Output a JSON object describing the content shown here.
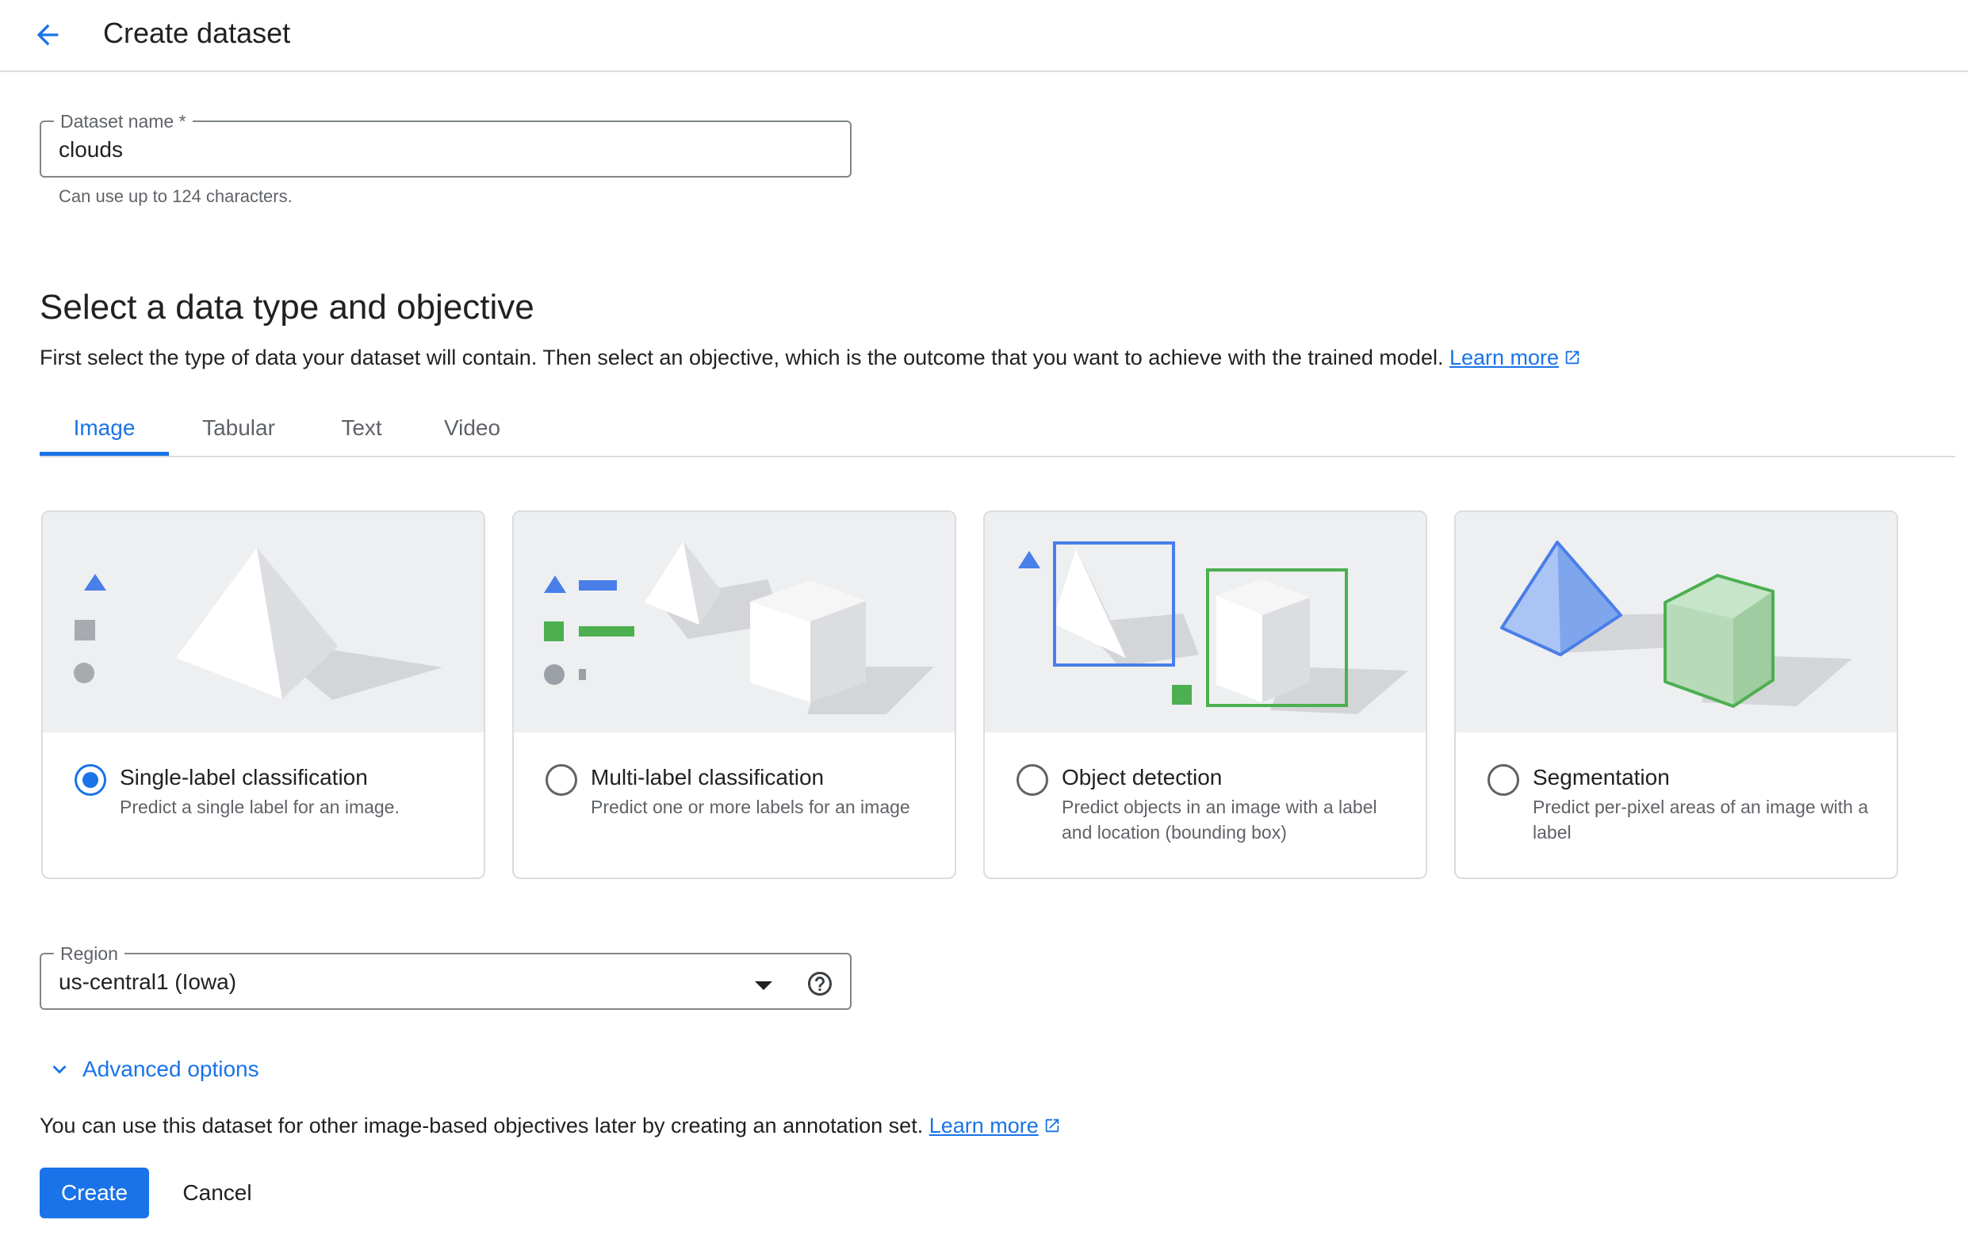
{
  "header": {
    "back_icon": "arrow-back-icon",
    "title": "Create dataset"
  },
  "dataset_name": {
    "label": "Dataset name *",
    "value": "clouds",
    "hint": "Can use up to 124 characters."
  },
  "section": {
    "title": "Select a data type and objective",
    "description": "First select the type of data your dataset will contain. Then select an objective, which is the outcome that you want to achieve with the trained model.",
    "learn_more": "Learn more"
  },
  "tabs": [
    {
      "label": "Image",
      "active": true
    },
    {
      "label": "Tabular",
      "active": false
    },
    {
      "label": "Text",
      "active": false
    },
    {
      "label": "Video",
      "active": false
    }
  ],
  "objectives": [
    {
      "title": "Single-label classification",
      "description": "Predict a single label for an image.",
      "selected": true
    },
    {
      "title": "Multi-label classification",
      "description": "Predict one or more labels for an image",
      "selected": false
    },
    {
      "title": "Object detection",
      "description": "Predict objects in an image with a label and location (bounding box)",
      "selected": false
    },
    {
      "title": "Segmentation",
      "description": "Predict per-pixel areas of an image with a label",
      "selected": false
    }
  ],
  "region": {
    "label": "Region",
    "value": "us-central1 (Iowa)",
    "help_icon": "help-circle-icon"
  },
  "advanced_options": {
    "label": "Advanced options",
    "icon": "chevron-down-icon"
  },
  "note": {
    "text": "You can use this dataset for other image-based objectives later by creating an annotation set.",
    "learn_more": "Learn more"
  },
  "actions": {
    "create": "Create",
    "cancel": "Cancel"
  },
  "colors": {
    "accent": "#1a73e8",
    "green": "#4caf50",
    "border": "#dadce0",
    "illustration_bg": "#eeeff1"
  }
}
